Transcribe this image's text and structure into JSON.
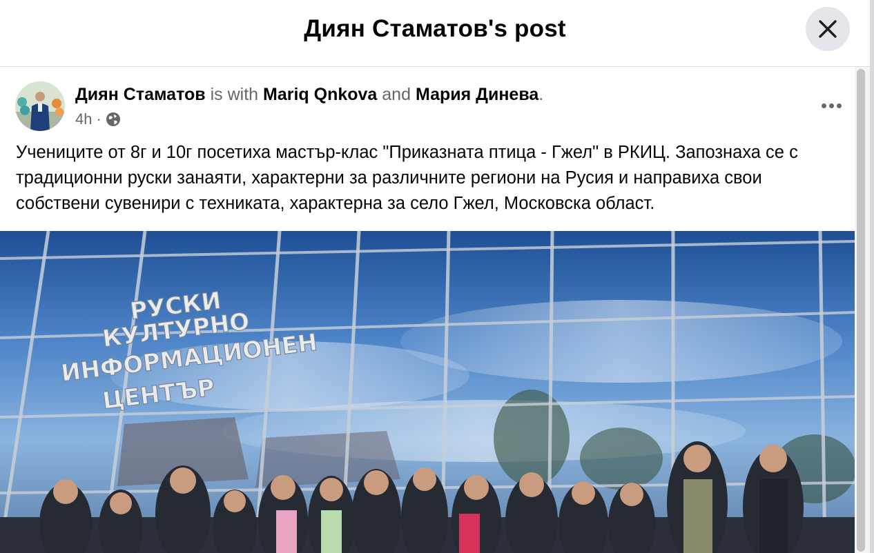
{
  "header": {
    "title": "Диян Стаматов's post",
    "close_icon": "close-icon"
  },
  "post": {
    "author": "Диян Стаматов",
    "with_text": " is with ",
    "tagged": [
      "Mariq Qnkova",
      "Мария Динева"
    ],
    "and_text": " and ",
    "end_punct": ".",
    "time": "4h",
    "separator": "·",
    "audience_icon": "globe-icon",
    "more_icon": "more-horizontal-icon",
    "text": "Учениците от 8г и 10г посетиха мастър-клас \"Приказната птица - Гжел\" в РКИЦ. Запознаха се с традиционни руски занаяти, характерни за различните региони на Русия и направиха свои собствени сувенири с техниката, характерна за село Гжел, Московска област."
  },
  "photo": {
    "sign_lines": [
      "РУСКИ",
      "КУЛТУРНО",
      "ИНФОРМАЦИОНЕН",
      "ЦЕНТЪР"
    ]
  }
}
